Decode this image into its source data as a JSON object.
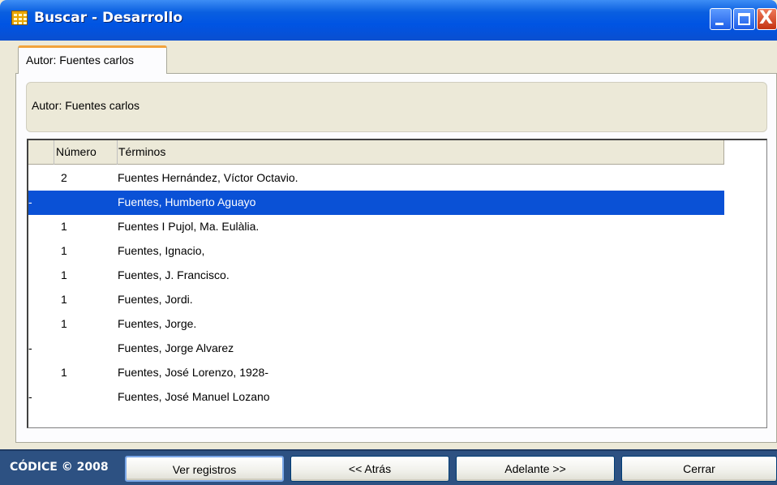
{
  "window": {
    "title": "Buscar  - Desarrollo",
    "minimize_icon": "minimize-icon",
    "maximize_icon": "maximize-icon",
    "close_icon": "close-icon",
    "close_glyph": "X"
  },
  "tab": {
    "label": "Autor: Fuentes carlos"
  },
  "groupbox": {
    "label": "Autor: Fuentes carlos"
  },
  "table": {
    "columns": {
      "number": "Número",
      "terms": "Términos"
    },
    "rows": [
      {
        "mark": "",
        "number": "2",
        "term": "Fuentes Hernández, Víctor Octavio."
      },
      {
        "mark": "-",
        "number": "",
        "term": "Fuentes, Humberto Aguayo"
      },
      {
        "mark": "",
        "number": "1",
        "term": "Fuentes I Pujol, Ma. Eulàlia."
      },
      {
        "mark": "",
        "number": "1",
        "term": "Fuentes, Ignacio,"
      },
      {
        "mark": "",
        "number": "1",
        "term": "Fuentes, J. Francisco."
      },
      {
        "mark": "",
        "number": "1",
        "term": "Fuentes, Jordi."
      },
      {
        "mark": "",
        "number": "1",
        "term": "Fuentes, Jorge."
      },
      {
        "mark": "-",
        "number": "",
        "term": "Fuentes, Jorge Alvarez"
      },
      {
        "mark": "",
        "number": "1",
        "term": "Fuentes, José Lorenzo, 1928-"
      },
      {
        "mark": "-",
        "number": "",
        "term": "Fuentes, José Manuel Lozano"
      }
    ],
    "selected_row": 1
  },
  "footer": {
    "brand": "CÓDICE © 2008",
    "buttons": {
      "view_records": "Ver registros",
      "back": "<< Atrás",
      "forward": "Adelante >>",
      "close": "Cerrar"
    }
  },
  "colors": {
    "titlebar": "#0054e3",
    "selection": "#0a51d6",
    "footer": "#2d5182",
    "tab_accent": "#f2a33c"
  }
}
